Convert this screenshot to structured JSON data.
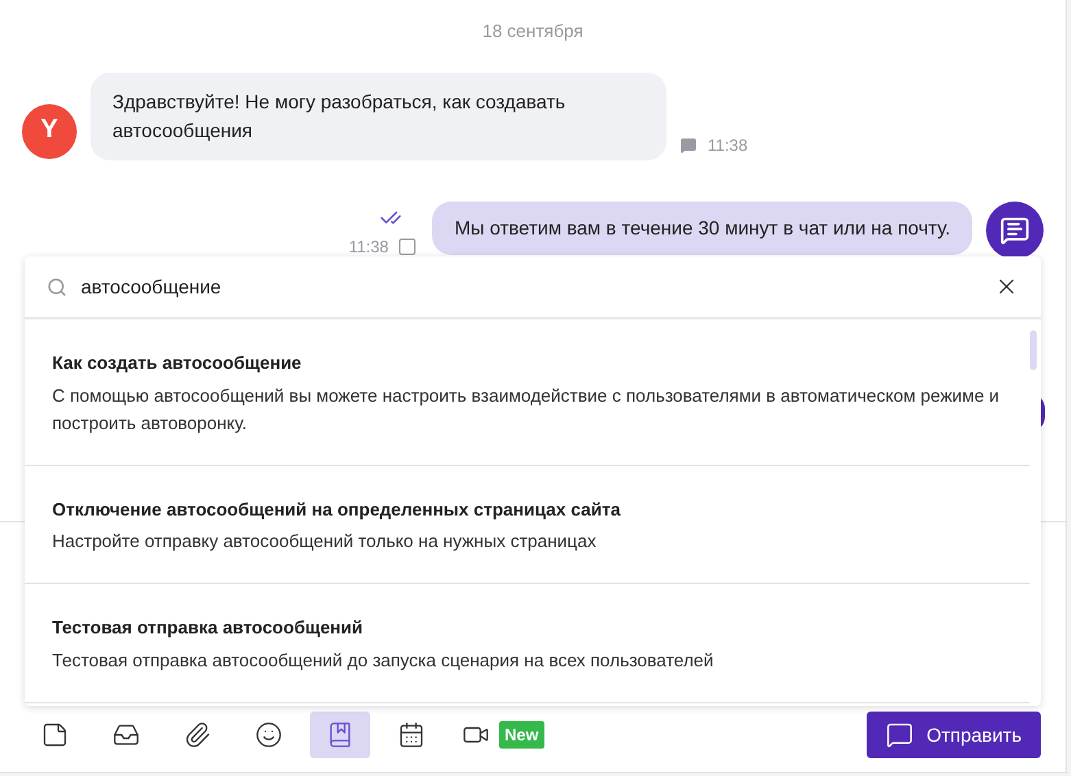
{
  "date_divider": "18 сентября",
  "messages": [
    {
      "kind": "incoming",
      "avatar": "Y",
      "text": "Здравствуйте! Не могу разобраться, как создавать автосообщения",
      "time": "11:38"
    },
    {
      "kind": "outgoing",
      "text": "Мы ответим вам в течение 30 минут в чат или на почту.",
      "time": "11:38",
      "read": true
    }
  ],
  "search_popup": {
    "value": "автосообщение",
    "results": [
      {
        "title": "Как создать автосообщение",
        "description": "С помощью автосообщений вы можете настроить взаимодействие с пользователями в автоматическом режиме и построить автоворонку."
      },
      {
        "title": "Отключение автосообщений на определенных страницах сайта",
        "description": "Настройте отправку автосообщений только на нужных страницах"
      },
      {
        "title": "Тестовая отправка автосообщений",
        "description": "Тестовая отправка автосообщений до запуска сценария на всех пользователей"
      }
    ]
  },
  "toolbar": [
    {
      "kind": "note",
      "selected": false
    },
    {
      "kind": "inbox",
      "selected": false
    },
    {
      "kind": "attach",
      "selected": false
    },
    {
      "kind": "emoji",
      "selected": false
    },
    {
      "kind": "book",
      "selected": true
    },
    {
      "kind": "calendar",
      "selected": false
    },
    {
      "kind": "video",
      "selected": false,
      "badge": "New"
    }
  ],
  "send_button": "Отправить"
}
